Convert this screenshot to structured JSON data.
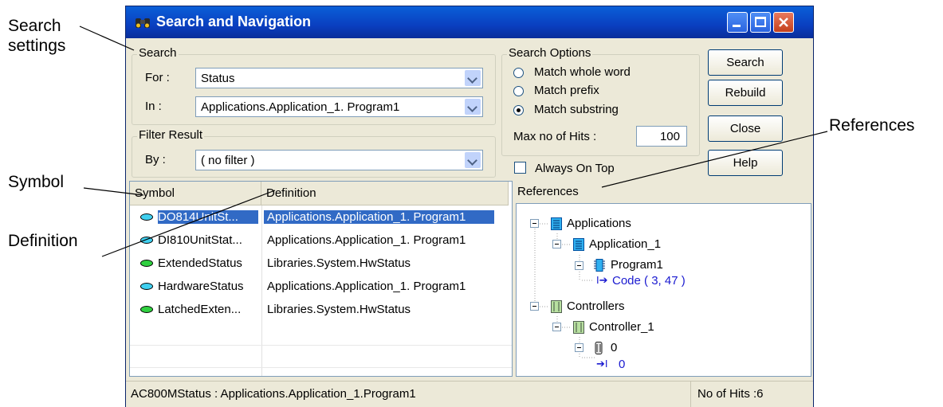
{
  "callouts": {
    "search_settings_line1": "Search",
    "search_settings_line2": "settings",
    "symbol": "Symbol",
    "definition": "Definition",
    "references": "References"
  },
  "window": {
    "title": "Search and Navigation",
    "title_icon": "binoculars-icon"
  },
  "search": {
    "legend": "Search",
    "for_label": "For :",
    "for_value": "Status",
    "in_label": "In :",
    "in_value": "Applications.Application_1. Program1"
  },
  "filter": {
    "legend": "Filter Result",
    "by_label": "By :",
    "by_value": "( no filter )"
  },
  "options": {
    "legend": "Search Options",
    "match_whole_word": "Match whole word",
    "match_prefix": "Match prefix",
    "match_substring": "Match substring",
    "selected": "Match substring",
    "max_hits_label": "Max no of Hits :",
    "max_hits_value": "100",
    "always_on_top": "Always On Top",
    "always_on_top_checked": false
  },
  "buttons": {
    "search": "Search",
    "rebuild": "Rebuild",
    "close": "Close",
    "help": "Help"
  },
  "results": {
    "columns": [
      "Symbol",
      "Definition"
    ],
    "rows": [
      {
        "symbol": "DO814UnitSt...",
        "definition": "Applications.Application_1. Program1",
        "dot_color": "#40d0f0",
        "selected": true
      },
      {
        "symbol": "DI810UnitStat...",
        "definition": "Applications.Application_1. Program1",
        "dot_color": "#40d0f0",
        "selected": false
      },
      {
        "symbol": "ExtendedStatus",
        "definition": "Libraries.System.HwStatus",
        "dot_color": "#30d040",
        "selected": false
      },
      {
        "symbol": "HardwareStatus",
        "definition": "Applications.Application_1. Program1",
        "dot_color": "#40d0f0",
        "selected": false
      },
      {
        "symbol": "LatchedExten...",
        "definition": "Libraries.System.HwStatus",
        "dot_color": "#30d040",
        "selected": false
      }
    ]
  },
  "references": {
    "header": "References",
    "tree": [
      {
        "label": "Applications",
        "icon": "application-icon"
      },
      {
        "label": "Application_1",
        "icon": "application-icon"
      },
      {
        "label": "Program1",
        "icon": "program-icon"
      },
      {
        "label": "Code ( 3, 47 )",
        "icon": "code-reference-icon"
      },
      {
        "label": "Controllers",
        "icon": "controller-icon"
      },
      {
        "label": "Controller_1",
        "icon": "controller-icon"
      },
      {
        "label": "0",
        "icon": "hardware-unit-icon"
      },
      {
        "label": "0",
        "icon": "hardware-reference-icon"
      }
    ]
  },
  "status": {
    "left": "AC800MStatus : Applications.Application_1.Program1",
    "right": "No of Hits :6"
  }
}
